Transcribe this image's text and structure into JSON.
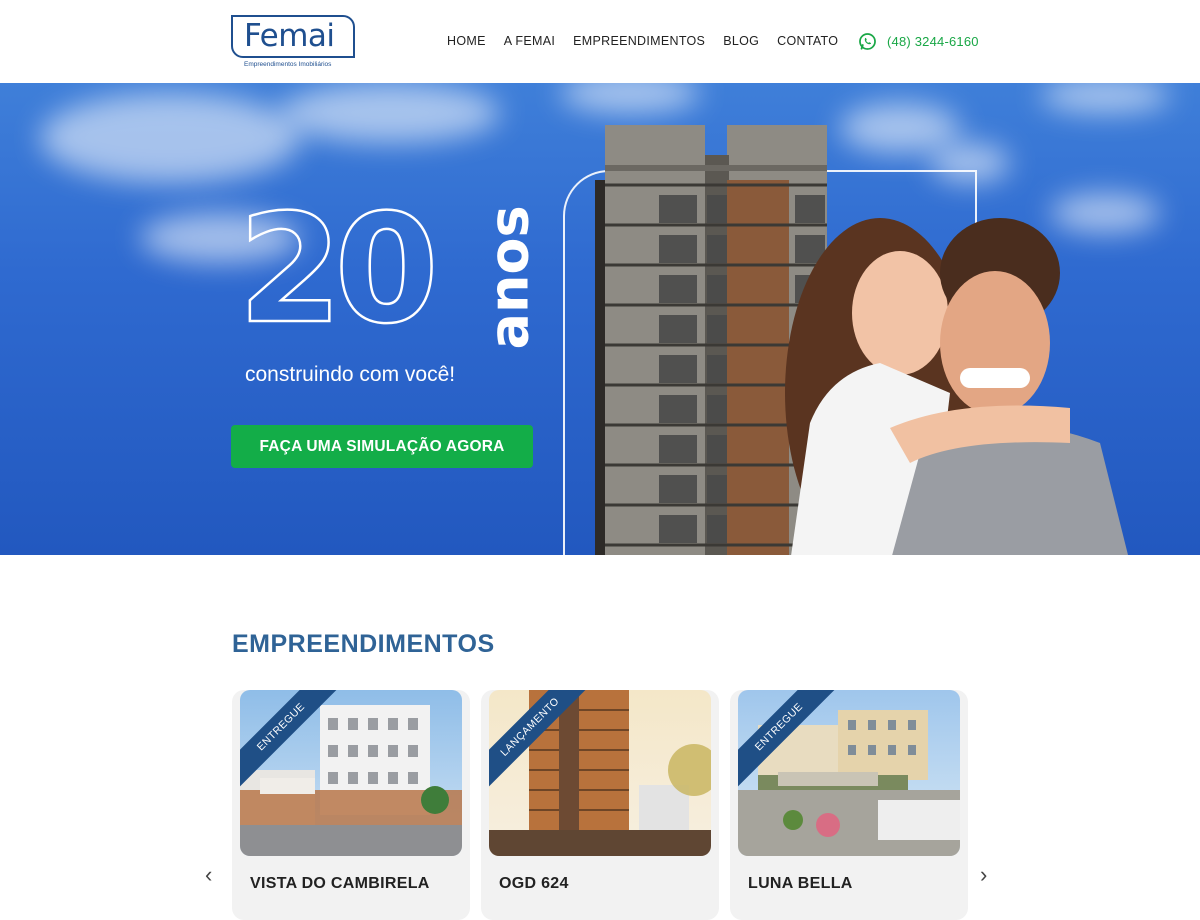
{
  "header": {
    "logo": {
      "word": "Femai",
      "sub": "Empreendimentos Imobiliários"
    },
    "nav": [
      "HOME",
      "A FEMAI",
      "EMPREENDIMENTOS",
      "BLOG",
      "CONTATO"
    ],
    "phone": "(48) 3244-6160"
  },
  "hero": {
    "big_number": "20",
    "anos": "anos",
    "tagline": "construindo com você!",
    "cta_label": "FAÇA UMA SIMULAÇÃO AGORA"
  },
  "section": {
    "title": "EMPREENDIMENTOS",
    "cards": [
      {
        "title": "VISTA DO CAMBIRELA",
        "ribbon": "ENTREGUE",
        "sub": ""
      },
      {
        "title": "OGD 624",
        "ribbon": "LANÇAMENTO",
        "sub": ""
      },
      {
        "title": "LUNA BELLA",
        "ribbon": "ENTREGUE",
        "sub": ""
      }
    ],
    "prev_arrow": "‹",
    "next_arrow": "›"
  },
  "colors": {
    "brand_blue": "#1f4f8f",
    "whatsapp_green": "#19a746",
    "cta_green": "#13ad48",
    "section_title": "#2f6396"
  }
}
